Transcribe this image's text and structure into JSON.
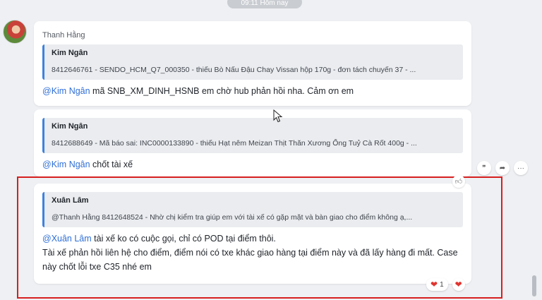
{
  "time_divider": "09:11 Hôm nay",
  "messages": [
    {
      "sender": "Thanh Hằng",
      "quote_name": "Kim Ngân",
      "quote_text": "8412646761 - SENDO_HCM_Q7_000350 - thiếu Bò Nấu Đậu Chay Vissan hộp 170g - đơn tách chuyến 37 - ...",
      "mention": "@Kim Ngân",
      "text": " mã SNB_XM_DINH_HSNB em chờ hub phản hồi nha. Cảm ơn em"
    },
    {
      "quote_name": "Kim Ngân",
      "quote_text": "8412688649 - Mã báo sai: INC0000133890 - thiếu Hạt nêm Meizan Thịt Thăn Xương Ống Tuỷ Cà Rốt 400g - ...",
      "mention": "@Kim Ngân",
      "text": " chốt tài xế"
    },
    {
      "quote_name": "Xuân Lâm",
      "quote_text": "@Thanh Hằng 8412648524 - Nhờ chị kiểm tra giúp em với tài xế có gặp mặt và bàn giao cho điểm không ạ,...",
      "mention": "@Xuân Lâm",
      "text": " tài xế ko có cuộc gọi, chỉ có POD tại điểm thôi.",
      "line2": "Tài xế phản hồi liên hệ cho điểm, điểm nói có txe khác giao hàng tại điểm này và đã lấy hàng đi mất. Case này chốt lỗi txe C35 nhé em"
    }
  ],
  "actions": {
    "quote_icon": "❞",
    "forward_icon": "➦",
    "more_icon": "···"
  },
  "reactions": {
    "heart_count": "1"
  },
  "colors": {
    "mention": "#2f6fd6",
    "highlight_border": "#d71f1f",
    "quote_bar": "#3d82e0"
  }
}
